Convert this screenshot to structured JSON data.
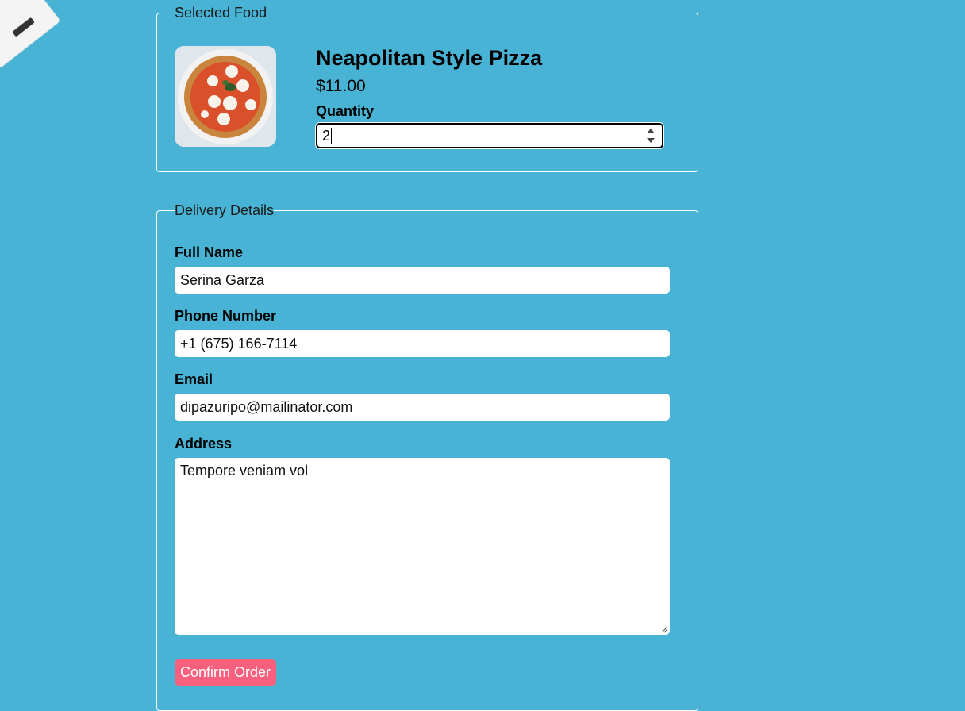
{
  "selected_food": {
    "legend": "Selected Food",
    "name": "Neapolitan Style Pizza",
    "price": "$11.00",
    "quantity_label": "Quantity",
    "quantity_value": "2"
  },
  "delivery": {
    "legend": "Delivery Details",
    "full_name_label": "Full Name",
    "full_name_value": "Serina Garza",
    "phone_label": "Phone Number",
    "phone_value": "+1 (675) 166-7114",
    "email_label": "Email",
    "email_value": "dipazuripo@mailinator.com",
    "address_label": "Address",
    "address_value": "Tempore veniam vol",
    "confirm_label": "Confirm Order"
  },
  "colors": {
    "background": "#48b3d4",
    "confirm_button": "#f8607e"
  }
}
